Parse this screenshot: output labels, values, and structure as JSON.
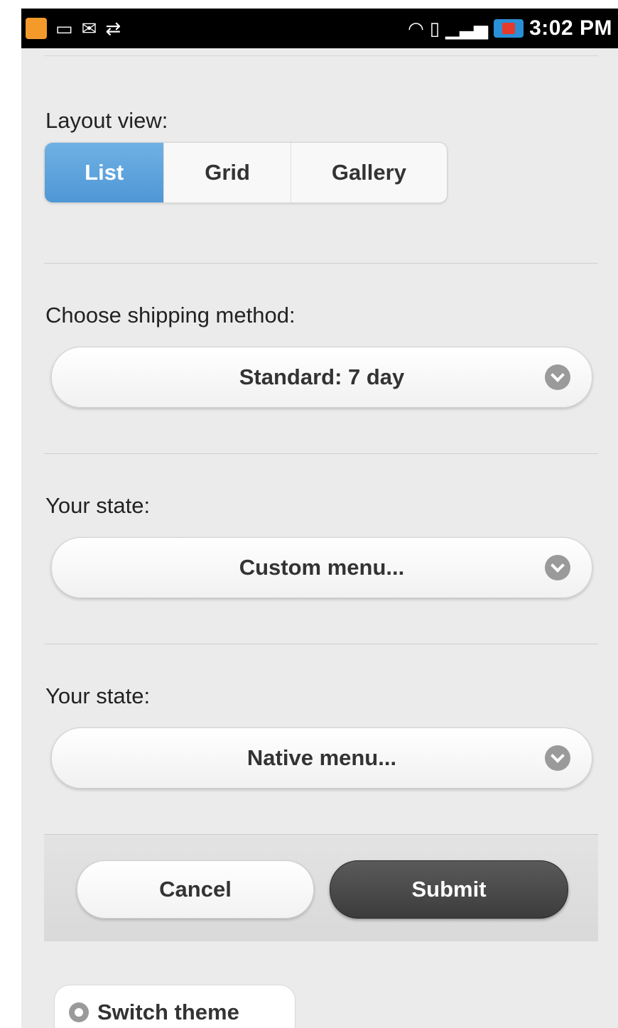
{
  "status_bar": {
    "time": "3:02 PM",
    "left_icons": [
      "photo-notification-icon",
      "message-icon",
      "gmail-icon",
      "usb-icon"
    ],
    "right_icons": [
      "wifi-icon",
      "vibrate-icon",
      "signal-icon",
      "battery-charging-icon"
    ]
  },
  "layout_view": {
    "label": "Layout view:",
    "options": [
      "List",
      "Grid",
      "Gallery"
    ],
    "selected": "List"
  },
  "shipping": {
    "label": "Choose shipping method:",
    "value": "Standard: 7 day"
  },
  "state_custom": {
    "label": "Your state:",
    "value": "Custom menu..."
  },
  "state_native": {
    "label": "Your state:",
    "value": "Native menu..."
  },
  "footer": {
    "cancel_label": "Cancel",
    "submit_label": "Submit"
  },
  "switch_theme": {
    "label": "Switch theme"
  },
  "colors": {
    "accent": "#5aa2dc",
    "submit_bg": "#4a4a4a",
    "page_bg": "#ebebeb"
  }
}
